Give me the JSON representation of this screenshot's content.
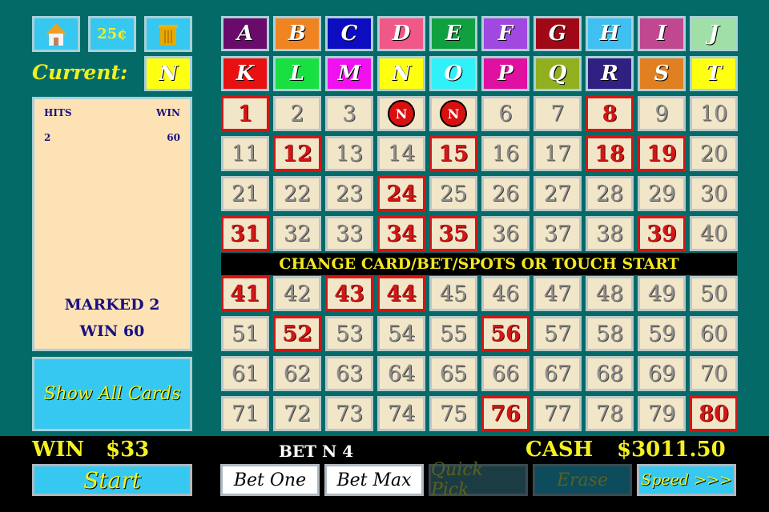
{
  "toolbar": {
    "home_icon": "house-icon",
    "denomination": "25¢",
    "trash_icon": "trash-can-icon"
  },
  "current": {
    "label": "Current:",
    "value": "N"
  },
  "paytable": {
    "hits_header": "HITS",
    "win_header": "WIN",
    "rows": [
      {
        "hits": "2",
        "win": "60"
      }
    ],
    "marked_text": "MARKED 2",
    "win_text": "WIN 60"
  },
  "show_all_cards": "Show All Cards",
  "cards": [
    {
      "l": "A",
      "c": "#6a0a6a"
    },
    {
      "l": "B",
      "c": "#f08420"
    },
    {
      "l": "C",
      "c": "#0c0cc0"
    },
    {
      "l": "D",
      "c": "#f05888"
    },
    {
      "l": "E",
      "c": "#10a040"
    },
    {
      "l": "F",
      "c": "#a048e0"
    },
    {
      "l": "G",
      "c": "#a00818"
    },
    {
      "l": "H",
      "c": "#40c0f0"
    },
    {
      "l": "I",
      "c": "#c04890"
    },
    {
      "l": "J",
      "c": "#a0e0a8"
    },
    {
      "l": "K",
      "c": "#e81010"
    },
    {
      "l": "L",
      "c": "#18e040"
    },
    {
      "l": "M",
      "c": "#f010f0"
    },
    {
      "l": "N",
      "c": "#ffff10"
    },
    {
      "l": "O",
      "c": "#30f0f8"
    },
    {
      "l": "P",
      "c": "#e010a0"
    },
    {
      "l": "Q",
      "c": "#90b020"
    },
    {
      "l": "R",
      "c": "#302080"
    },
    {
      "l": "S",
      "c": "#e08020"
    },
    {
      "l": "T",
      "c": "#ffff10"
    }
  ],
  "marked_numbers": [
    1,
    8,
    12,
    15,
    18,
    19,
    24,
    31,
    34,
    35,
    39,
    41,
    43,
    44,
    52,
    56,
    76,
    80
  ],
  "hit_numbers": [
    4,
    5
  ],
  "hit_label": "N",
  "banner": "CHANGE CARD/BET/SPOTS OR TOUCH START",
  "bottom": {
    "win_label": "WIN",
    "win_value": "$33",
    "bet_text": "BET N 4",
    "cash_label": "CASH",
    "cash_value": "$3011.50"
  },
  "buttons": {
    "start": "Start",
    "bet_one": "Bet One",
    "bet_max": "Bet Max",
    "quick_pick": "Quick Pick",
    "erase": "Erase",
    "speed": "Speed >>>"
  }
}
